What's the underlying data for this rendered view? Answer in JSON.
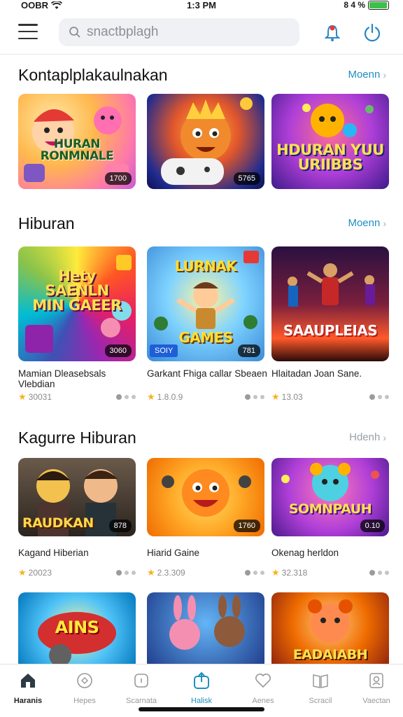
{
  "status": {
    "carrier": "OOBR",
    "time": "1:3 PM",
    "battery": "8 4 %",
    "battery_level": 0.95
  },
  "search": {
    "placeholder": "snactbplagh"
  },
  "sections": [
    {
      "title": "Kontaplplakaulnakan",
      "more": "Moenn",
      "cards": [
        {
          "label": "HURAN RONMNALE",
          "badge": "1700"
        },
        {
          "label": "",
          "badge": "5765"
        },
        {
          "label": "HDURAN YUU URIIBBS",
          "badge": ""
        }
      ]
    },
    {
      "title": "Hiburan",
      "more": "Moenn",
      "cards": [
        {
          "label": "Hety SAENLN MIN GAEER",
          "badge": "3060",
          "title": "Mamian Dleasebsals Vlebdian",
          "rating": "30031"
        },
        {
          "label": "LURNAK GAMES",
          "badge": "781",
          "badge_left": "SOIY",
          "title": "Garkant Fhiga callar Sbeaen",
          "rating": "1.8.0.9"
        },
        {
          "label": "SAAUPLEIAS",
          "badge": "",
          "title": "Hlaitadan Joan Sane.",
          "rating": "13.03"
        }
      ]
    },
    {
      "title": "Kagurre Hiburan",
      "more": "Hdenh",
      "cards": [
        {
          "label": "RAUDKAN",
          "badge": "878",
          "title": "Kagand Hiberian",
          "rating": "20023"
        },
        {
          "label": "",
          "badge": "1760",
          "title": "Hiarid Gaine",
          "rating": "2.3.309"
        },
        {
          "label": "SOMNPAUH",
          "badge": "0.10",
          "title": "Okenag herldon",
          "rating": "32.318"
        }
      ]
    },
    {
      "cards": [
        {
          "label": "AINS"
        },
        {
          "label": ""
        },
        {
          "label": "EADAIABH"
        }
      ]
    }
  ],
  "tabs": [
    {
      "label": "Haranis",
      "icon": "home-icon"
    },
    {
      "label": "Hepes",
      "icon": "gamepad-icon"
    },
    {
      "label": "Scarnata",
      "icon": "card-icon"
    },
    {
      "label": "Halisk",
      "icon": "upload-icon"
    },
    {
      "label": "Aenes",
      "icon": "heart-icon"
    },
    {
      "label": "Scracil",
      "icon": "book-icon"
    },
    {
      "label": "Vaectan",
      "icon": "profile-icon"
    }
  ],
  "colors": {
    "accent": "#1f8fc2",
    "star": "#f2b51b",
    "tab_inactive": "#999999"
  }
}
